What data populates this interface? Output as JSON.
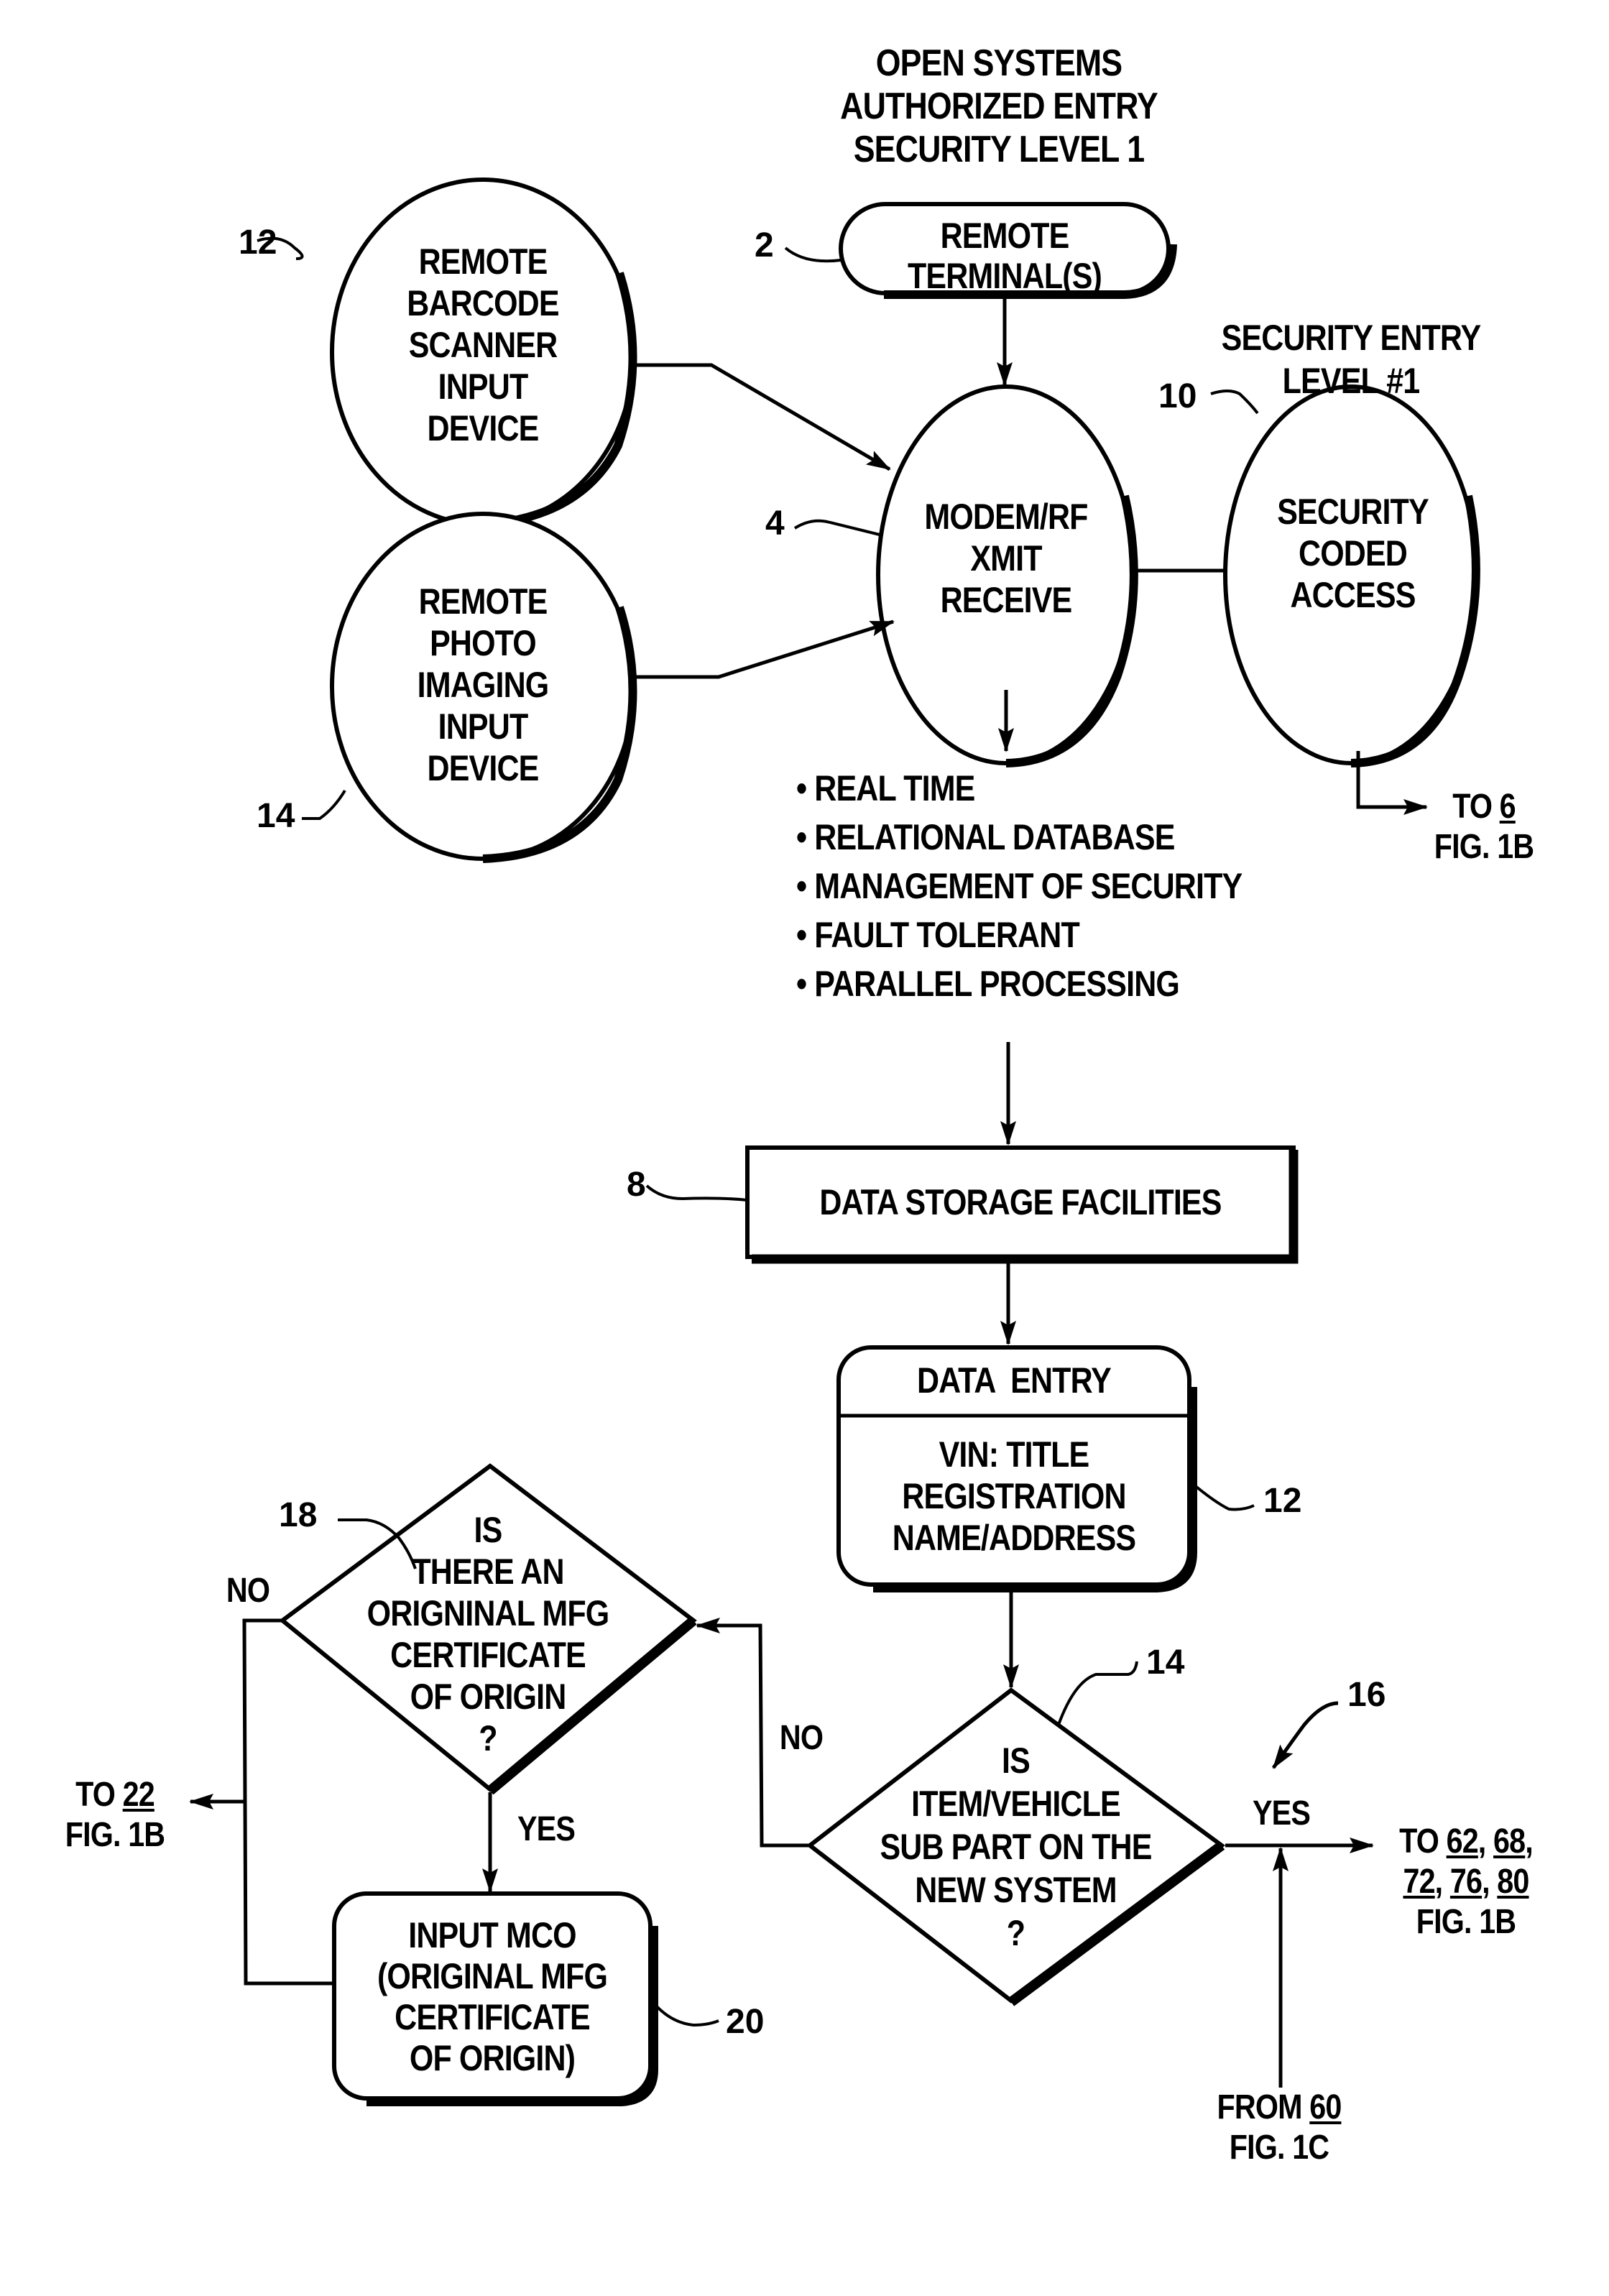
{
  "header": {
    "title_lines": [
      "OPEN SYSTEMS",
      "AUTHORIZED ENTRY",
      "SECURITY LEVEL 1"
    ]
  },
  "nodes": {
    "remote_terminal": {
      "ref": "2",
      "lines": [
        "REMOTE",
        "TERMINAL(S)"
      ]
    },
    "barcode_scanner": {
      "ref": "12",
      "lines": [
        "REMOTE",
        "BARCODE",
        "SCANNER",
        "INPUT",
        "DEVICE"
      ]
    },
    "photo_imaging": {
      "ref": "14",
      "lines": [
        "REMOTE",
        "PHOTO",
        "IMAGING",
        "INPUT",
        "DEVICE"
      ]
    },
    "modem": {
      "ref": "4",
      "lines": [
        "MODEM/RF",
        "XMIT",
        "RECEIVE"
      ]
    },
    "security_access": {
      "ref": "10",
      "lines": [
        "SECURITY",
        "CODED",
        "ACCESS"
      ],
      "heading_lines": [
        "SECURITY ENTRY",
        "LEVEL #1"
      ]
    },
    "data_storage": {
      "ref": "8",
      "label": "DATA STORAGE FACILITIES"
    },
    "data_entry": {
      "ref": "12",
      "header": "DATA  ENTRY",
      "lines": [
        "VIN: TITLE",
        "REGISTRATION",
        "NAME/ADDRESS"
      ]
    },
    "decision_new_system": {
      "ref": "14",
      "lines": [
        "IS",
        "ITEM/VEHICLE",
        "SUB PART ON THE",
        "NEW SYSTEM",
        "?"
      ]
    },
    "decision_mco": {
      "ref": "18",
      "lines": [
        "IS",
        "THERE AN",
        "ORIGNINAL MFG",
        "CERTIFICATE",
        "OF ORIGIN",
        "?"
      ]
    },
    "input_mco": {
      "ref": "20",
      "lines": [
        "INPUT MCO",
        "(ORIGINAL MFG",
        "CERTIFICATE",
        "OF ORIGIN)"
      ]
    }
  },
  "features": [
    "REAL TIME",
    "RELATIONAL DATABASE",
    "MANAGEMENT OF SECURITY",
    "FAULT TOLERANT",
    "PARALLEL PROCESSING"
  ],
  "connectors": {
    "to_6": {
      "prefix": "TO ",
      "ref": "6",
      "fig": "FIG. 1B"
    },
    "to_22": {
      "prefix": "TO ",
      "ref": "22",
      "fig": "FIG. 1B"
    },
    "to_62": {
      "prefix": "TO ",
      "refs_line1": [
        "62",
        "68"
      ],
      "refs_line2": [
        "72",
        "76",
        "80"
      ],
      "fig": "FIG. 1B"
    },
    "from_60": {
      "prefix": "FROM ",
      "ref": "60",
      "fig": "FIG. 1C"
    }
  },
  "branch_labels": {
    "no_left": "NO",
    "no_mid": "NO",
    "yes_mco": "YES",
    "yes_new_system": "YES"
  },
  "figure_ref": "16"
}
